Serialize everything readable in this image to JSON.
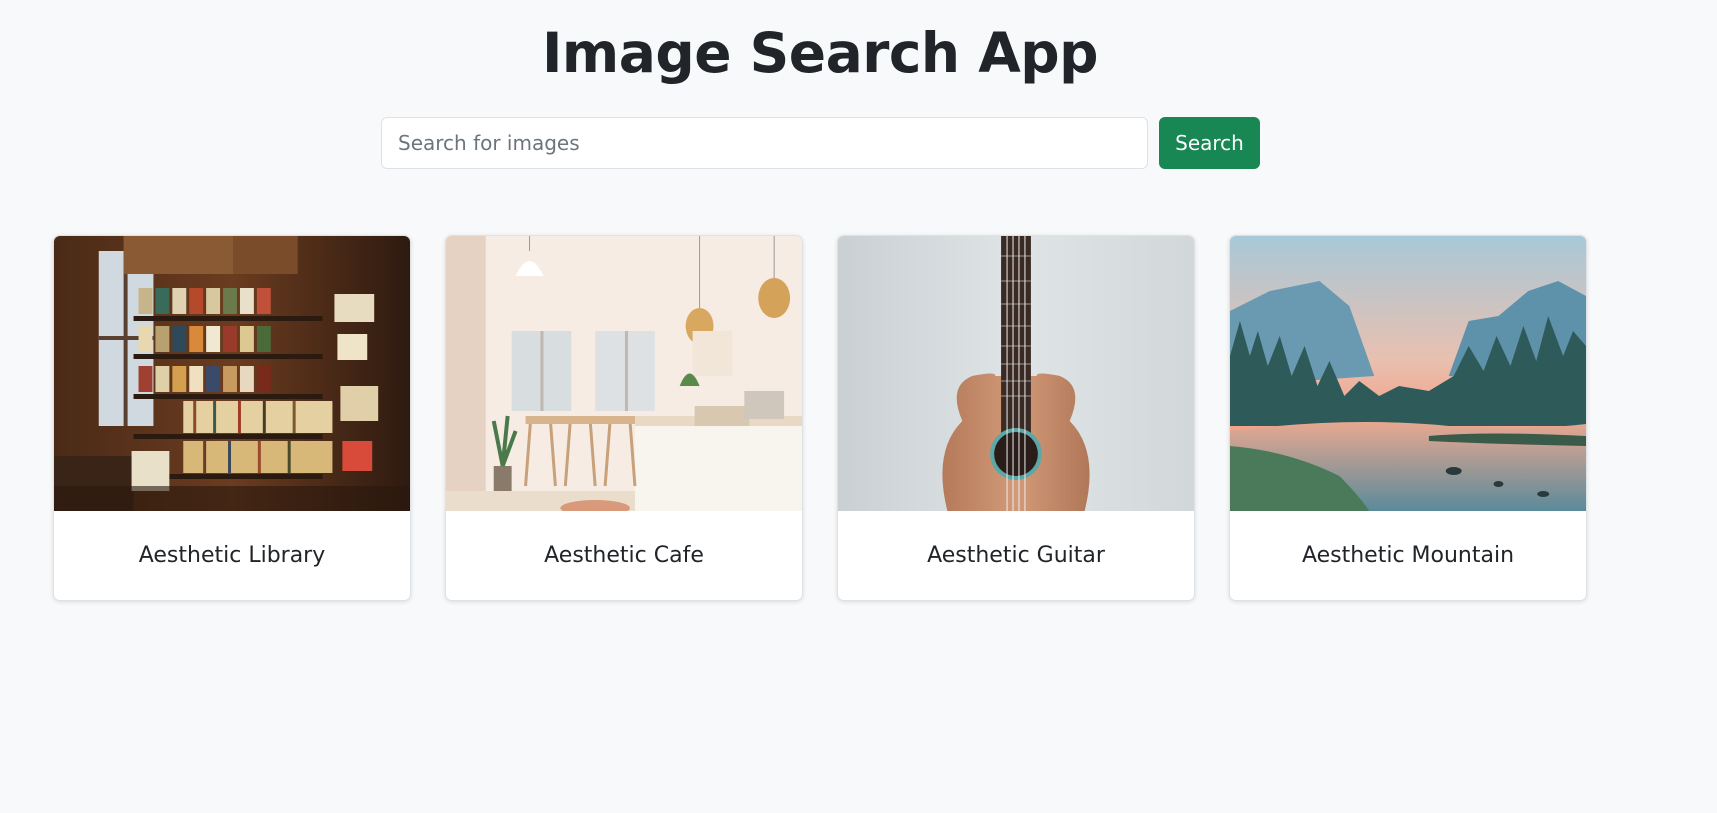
{
  "header": {
    "title": "Image Search App"
  },
  "search": {
    "placeholder": "Search for images",
    "value": "",
    "button_label": "Search",
    "button_color": "#198754"
  },
  "results": [
    {
      "title": "Aesthetic Library",
      "image": "bookstore-shelves-photo"
    },
    {
      "title": "Aesthetic Cafe",
      "image": "bright-cafe-interior-photo"
    },
    {
      "title": "Aesthetic Guitar",
      "image": "ukulele-against-wall-photo"
    },
    {
      "title": "Aesthetic Mountain",
      "image": "mountain-river-sunset-photo"
    }
  ]
}
